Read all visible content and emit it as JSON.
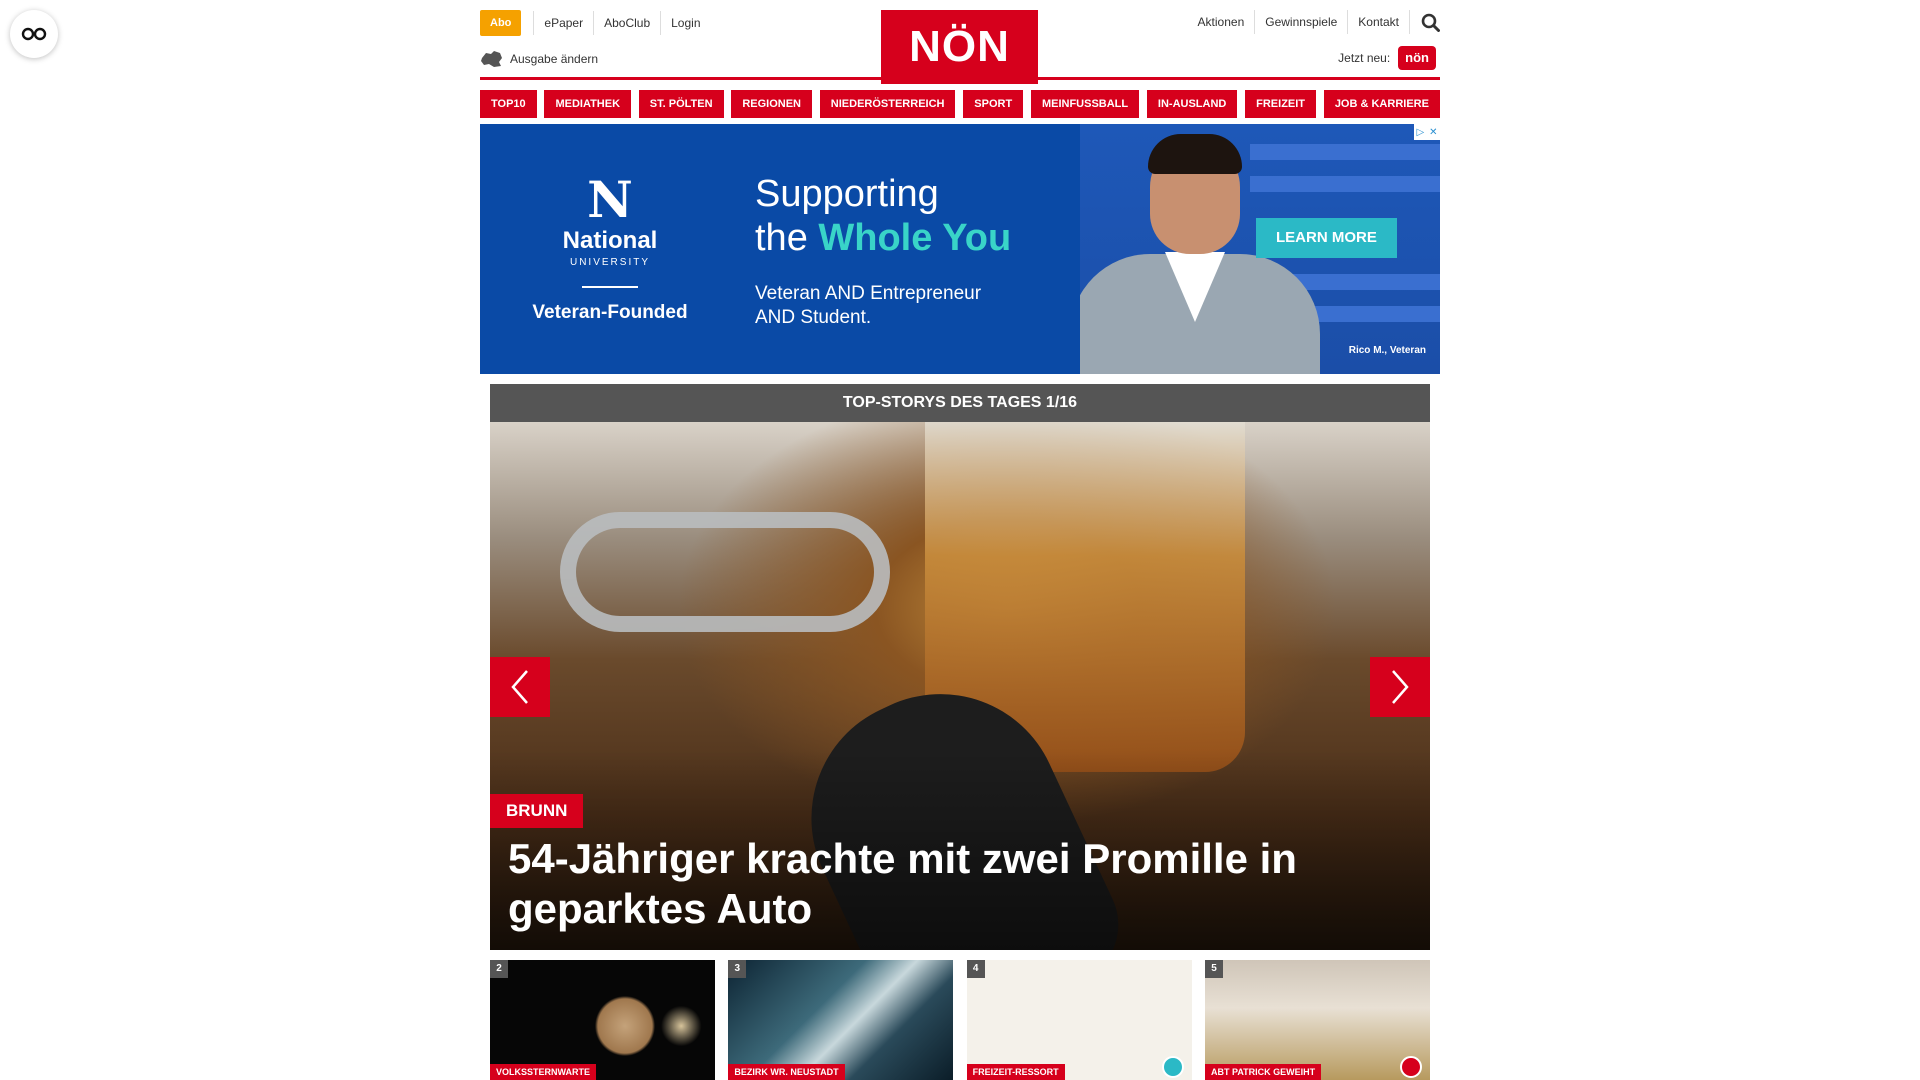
{
  "header": {
    "abo": "Abo",
    "left_links": [
      "ePaper",
      "AboClub",
      "Login"
    ],
    "ausgabe": "Ausgabe ändern",
    "logo": "NÖN",
    "right_links": [
      "Aktionen",
      "Gewinnspiele",
      "Kontakt"
    ],
    "jetzt_neu": "Jetzt neu:",
    "jetzt_badge": "nön"
  },
  "nav": {
    "items": [
      "TOP10",
      "MEDIATHEK",
      "ST. PÖLTEN",
      "REGIONEN",
      "NIEDERÖSTERREICH",
      "SPORT",
      "MEINFUSSBALL",
      "IN-AUSLAND",
      "FREIZEIT",
      "JOB & KARRIERE"
    ]
  },
  "ad": {
    "logo_letter": "N",
    "logo_name": "National",
    "logo_sub": "UNIVERSITY",
    "founded": "Veteran-Founded",
    "headline_1": "Supporting",
    "headline_2a": "the ",
    "headline_2b": "Whole You",
    "sub_1": "Veteran AND Entrepreneur",
    "sub_2": "AND Student.",
    "button": "LEARN MORE",
    "caption": "Rico M., Veteran",
    "colors": {
      "background": "#0a4aa6",
      "accent": "#39d4c8",
      "button": "#2bb9c6"
    }
  },
  "stories": {
    "header": "TOP-STORYS DES TAGES 1/16",
    "hero": {
      "tag": "BRUNN",
      "title": "54-Jähriger krachte mit zwei Promille in geparktes Auto"
    },
    "thumbs": [
      {
        "num": "2",
        "label": "VOLKSSTERNWARTE"
      },
      {
        "num": "3",
        "label": "BEZIRK WR. NEUSTADT"
      },
      {
        "num": "4",
        "label": "FREIZEIT-RESSORT"
      },
      {
        "num": "5",
        "label": "ABT PATRICK GEWEIHT"
      }
    ]
  },
  "colors": {
    "brand": "#d6001c",
    "abo": "#f5a100",
    "story_header": "#555555"
  }
}
